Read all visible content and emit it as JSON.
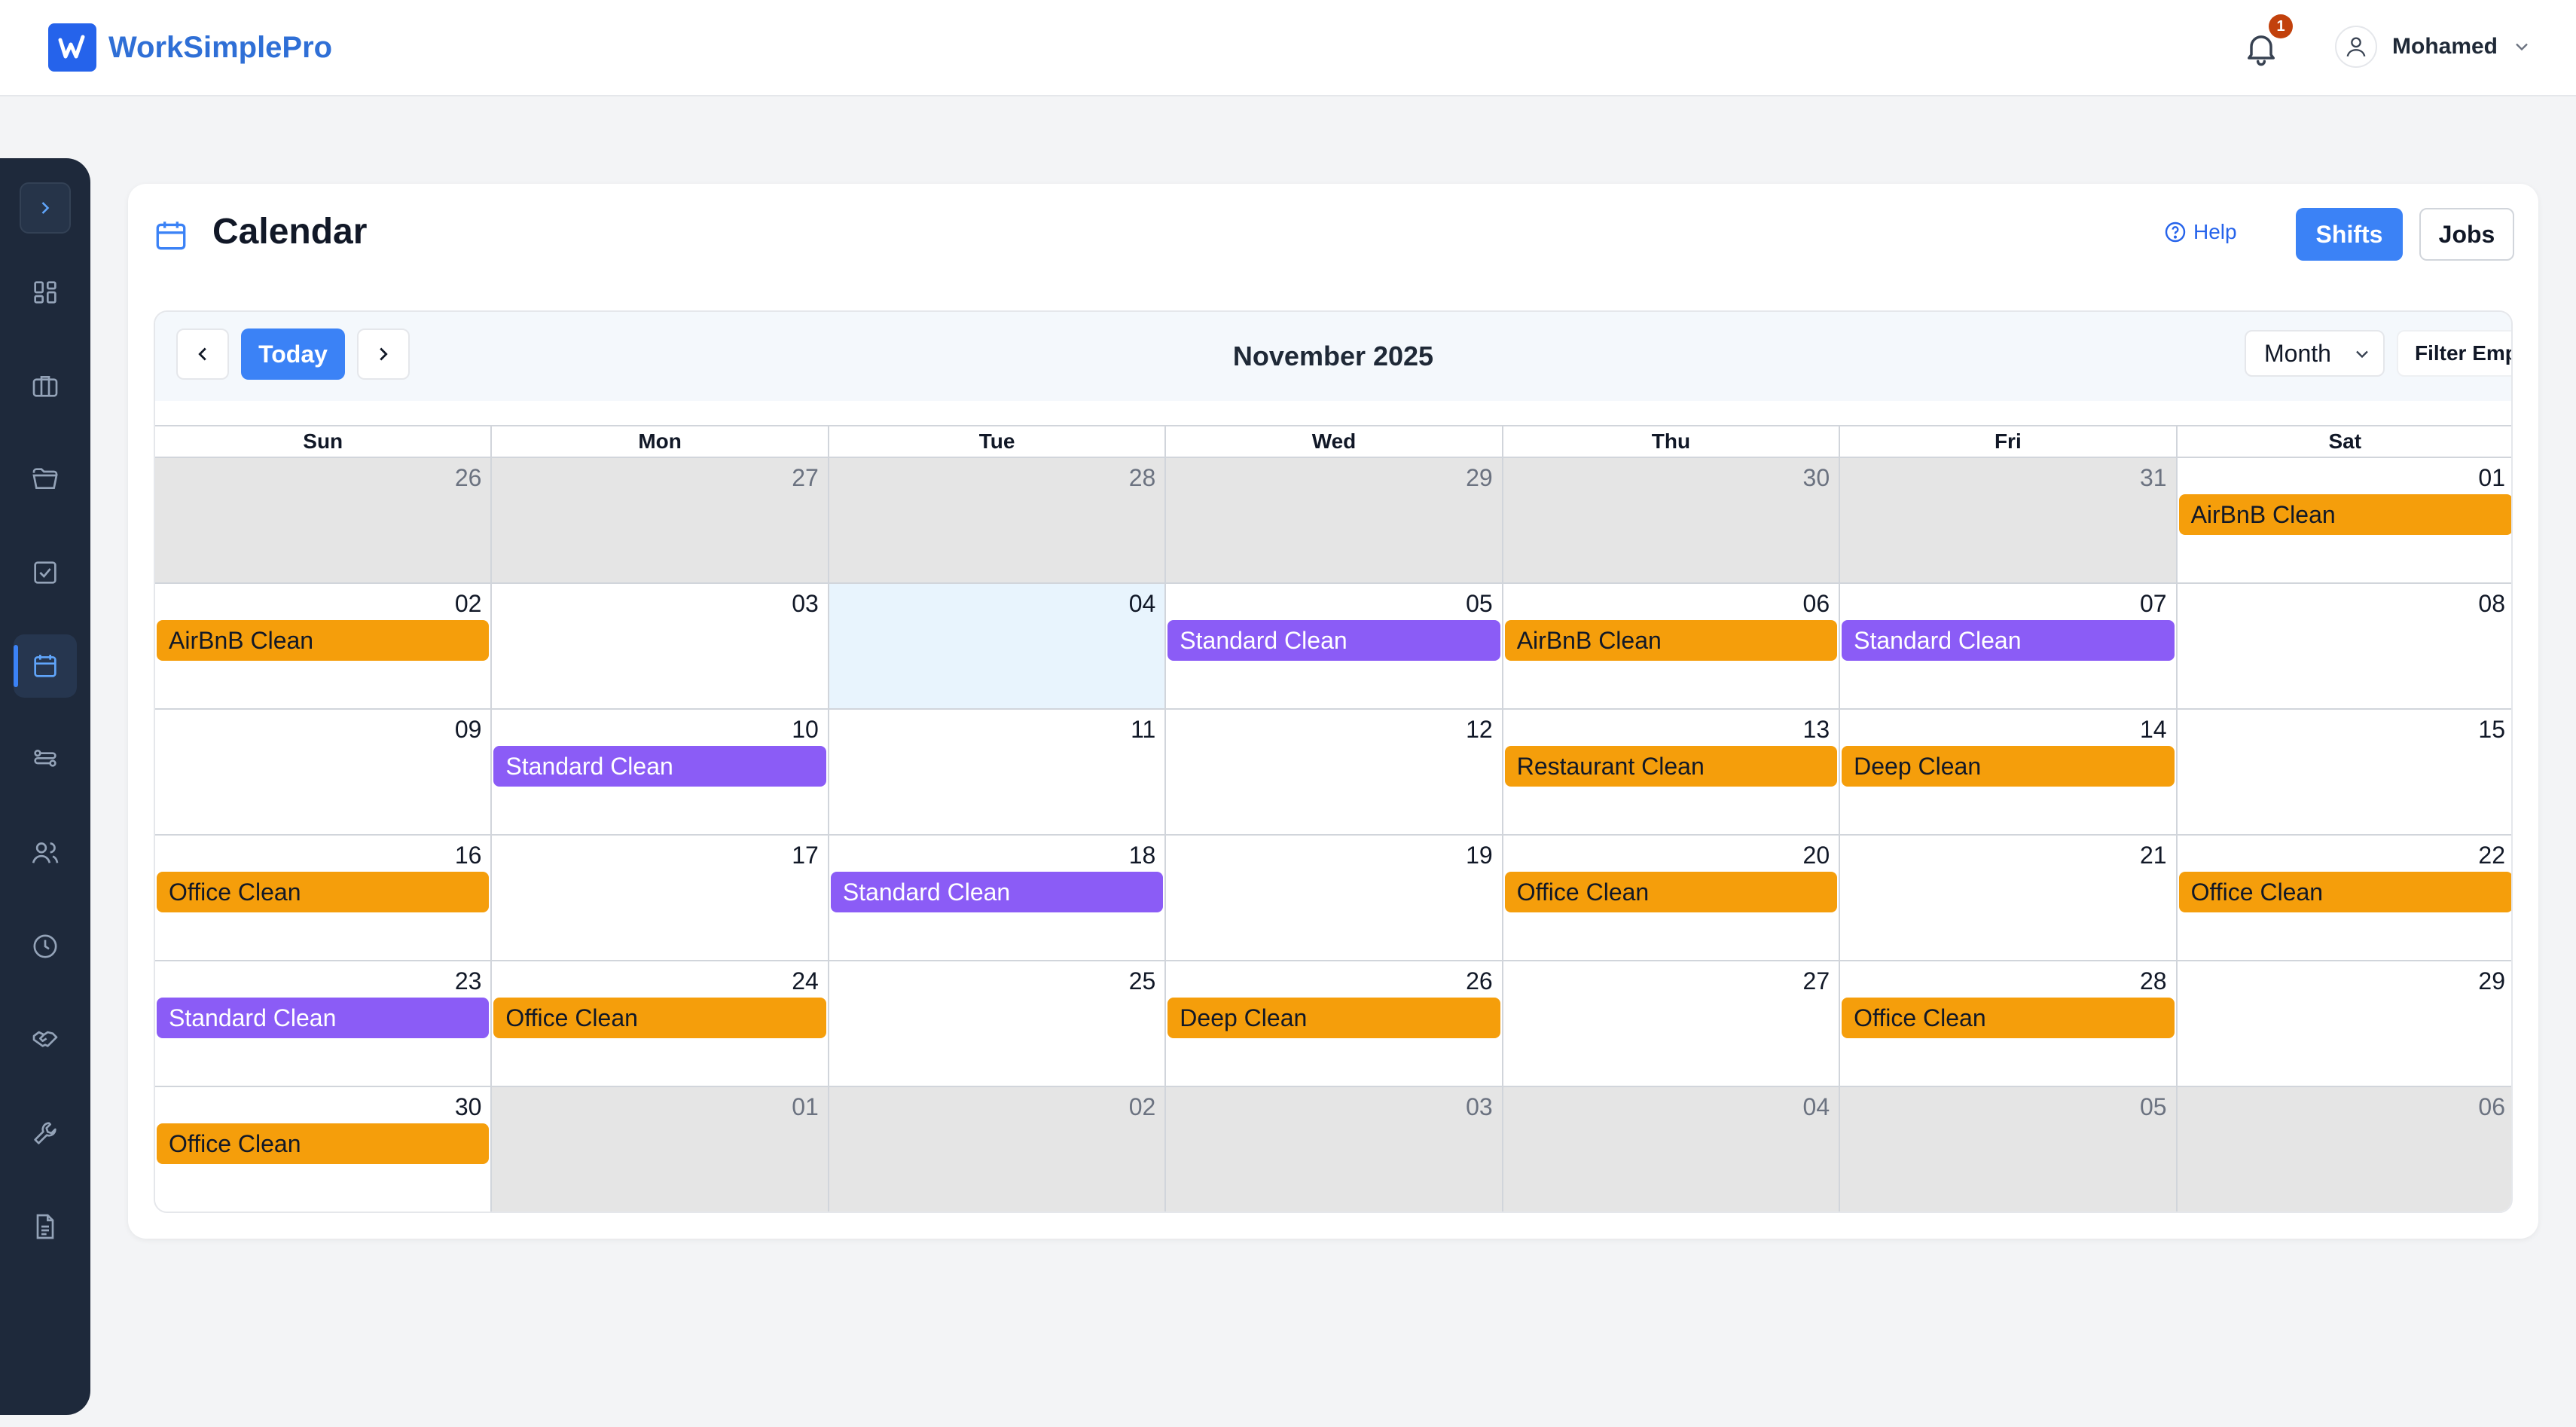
{
  "app": {
    "name": "WorkSimplePro"
  },
  "header": {
    "notification_count": "1",
    "user_name": "Mohamed"
  },
  "sidebar": {
    "items": [
      {
        "icon": "dashboard-icon"
      },
      {
        "icon": "briefcase-icon"
      },
      {
        "icon": "folder-icon"
      },
      {
        "icon": "checkbox-icon"
      },
      {
        "icon": "calendar-icon",
        "active": true
      },
      {
        "icon": "workflow-icon"
      },
      {
        "icon": "users-icon"
      },
      {
        "icon": "clock-icon"
      },
      {
        "icon": "handshake-icon"
      },
      {
        "icon": "wrench-icon"
      },
      {
        "icon": "document-icon"
      }
    ]
  },
  "page": {
    "title": "Calendar",
    "help_label": "Help",
    "shifts_label": "Shifts",
    "jobs_label": "Jobs"
  },
  "calendar": {
    "today_label": "Today",
    "month_label": "November 2025",
    "view_value": "Month",
    "filter_label": "Filter Employee",
    "days_of_week": [
      "Sun",
      "Mon",
      "Tue",
      "Wed",
      "Thu",
      "Fri",
      "Sat"
    ],
    "cells": [
      {
        "day": "26",
        "outside": true
      },
      {
        "day": "27",
        "outside": true
      },
      {
        "day": "28",
        "outside": true
      },
      {
        "day": "29",
        "outside": true
      },
      {
        "day": "30",
        "outside": true
      },
      {
        "day": "31",
        "outside": true
      },
      {
        "day": "01",
        "event": "AirBnB Clean",
        "color": "orange"
      },
      {
        "day": "02",
        "event": "AirBnB Clean",
        "color": "orange"
      },
      {
        "day": "03"
      },
      {
        "day": "04",
        "today": true
      },
      {
        "day": "05",
        "event": "Standard Clean",
        "color": "purple"
      },
      {
        "day": "06",
        "event": "AirBnB Clean",
        "color": "orange"
      },
      {
        "day": "07",
        "event": "Standard Clean",
        "color": "purple"
      },
      {
        "day": "08"
      },
      {
        "day": "09"
      },
      {
        "day": "10",
        "event": "Standard Clean",
        "color": "purple"
      },
      {
        "day": "11"
      },
      {
        "day": "12"
      },
      {
        "day": "13",
        "event": "Restaurant Clean",
        "color": "orange"
      },
      {
        "day": "14",
        "event": "Deep Clean",
        "color": "orange"
      },
      {
        "day": "15"
      },
      {
        "day": "16",
        "event": "Office Clean",
        "color": "orange"
      },
      {
        "day": "17"
      },
      {
        "day": "18",
        "event": "Standard Clean",
        "color": "purple"
      },
      {
        "day": "19"
      },
      {
        "day": "20",
        "event": "Office Clean",
        "color": "orange"
      },
      {
        "day": "21"
      },
      {
        "day": "22",
        "event": "Office Clean",
        "color": "orange"
      },
      {
        "day": "23",
        "event": "Standard Clean",
        "color": "purple"
      },
      {
        "day": "24",
        "event": "Office Clean",
        "color": "orange"
      },
      {
        "day": "25"
      },
      {
        "day": "26",
        "event": "Deep Clean",
        "color": "orange"
      },
      {
        "day": "27"
      },
      {
        "day": "28",
        "event": "Office Clean",
        "color": "orange"
      },
      {
        "day": "29"
      },
      {
        "day": "30",
        "event": "Office Clean",
        "color": "orange"
      },
      {
        "day": "01",
        "outside": true
      },
      {
        "day": "02",
        "outside": true
      },
      {
        "day": "03",
        "outside": true
      },
      {
        "day": "04",
        "outside": true
      },
      {
        "day": "05",
        "outside": true
      },
      {
        "day": "06",
        "outside": true
      }
    ]
  },
  "colors": {
    "primary": "#3b82f6",
    "event_orange": "#f59e0b",
    "event_purple": "#8b5cf6",
    "sidebar": "#1e293b"
  }
}
